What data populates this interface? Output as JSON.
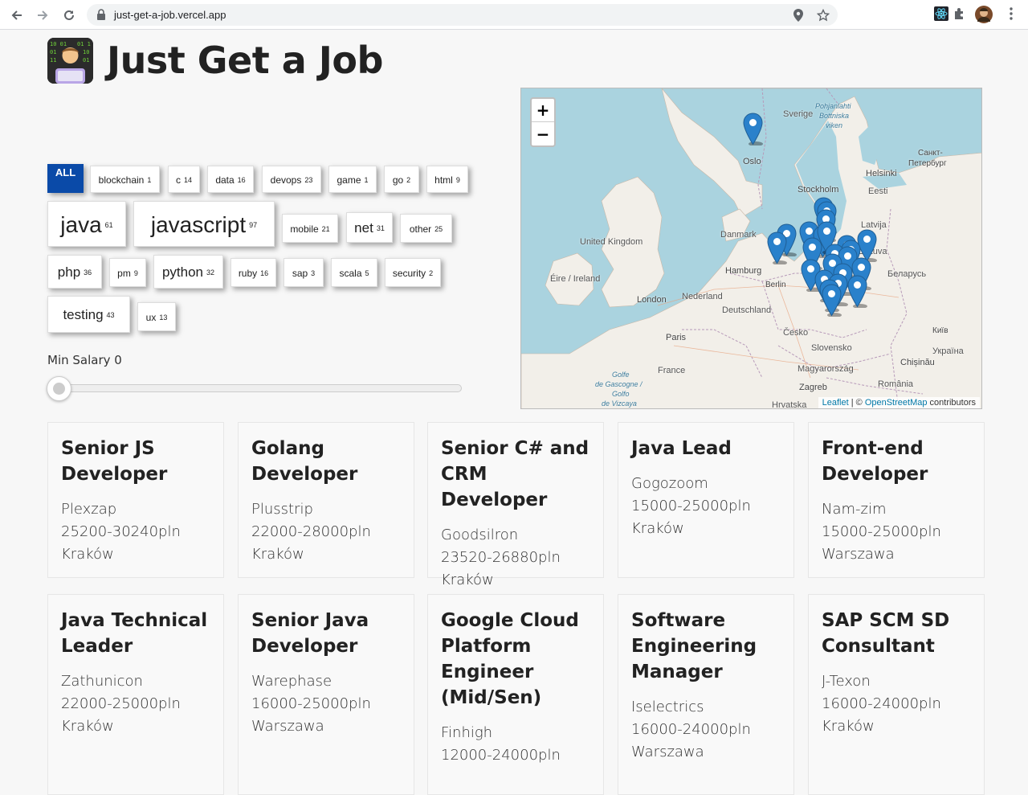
{
  "browser": {
    "url": "just-get-a-job.vercel.app"
  },
  "header": {
    "title": "Just Get a Job"
  },
  "filters": {
    "tags": [
      {
        "label": "ALL",
        "count": ""
      },
      {
        "label": "blockchain",
        "count": "1"
      },
      {
        "label": "c",
        "count": "14"
      },
      {
        "label": "data",
        "count": "16"
      },
      {
        "label": "devops",
        "count": "23"
      },
      {
        "label": "game",
        "count": "1"
      },
      {
        "label": "go",
        "count": "2"
      },
      {
        "label": "html",
        "count": "9"
      },
      {
        "label": "java",
        "count": "61"
      },
      {
        "label": "javascript",
        "count": "97"
      },
      {
        "label": "mobile",
        "count": "21"
      },
      {
        "label": "net",
        "count": "31"
      },
      {
        "label": "other",
        "count": "25"
      },
      {
        "label": "php",
        "count": "36"
      },
      {
        "label": "pm",
        "count": "9"
      },
      {
        "label": "python",
        "count": "32"
      },
      {
        "label": "ruby",
        "count": "16"
      },
      {
        "label": "sap",
        "count": "3"
      },
      {
        "label": "scala",
        "count": "5"
      },
      {
        "label": "security",
        "count": "2"
      },
      {
        "label": "testing",
        "count": "43"
      },
      {
        "label": "ux",
        "count": "13"
      }
    ],
    "salary_label": "Min Salary 0",
    "salary_value": 0
  },
  "map": {
    "zoom_in": "+",
    "zoom_out": "−",
    "labels": {
      "sverige": "Sverige",
      "bothnian": "Pohjanlahti",
      "bothnian2": "Bottniska",
      "bothnian3": "viken",
      "spb": "Санкт-",
      "spb2": "Петербург",
      "helsinki": "Helsinki",
      "oslo": "Oslo",
      "stockholm": "Stockholm",
      "eesti": "Eesti",
      "latvija": "Latvija",
      "danmark": "Danmark",
      "lietuva": "Lietuva",
      "uk": "United Kingdom",
      "hamburg": "Hamburg",
      "berlin": "Berlin",
      "belarus": "Беларусь",
      "eire": "Éire / Ireland",
      "nederland": "Nederland",
      "london": "London",
      "deutschland": "Deutschland",
      "kyiv": "Київ",
      "cesko": "Česko",
      "paris": "Paris",
      "slovensko": "Slovensko",
      "ukraina": "Україна",
      "france": "France",
      "magyar": "Magyarország",
      "chisinau": "Chișinău",
      "golfe1": "Golfe",
      "golfe2": "de Gascogne /",
      "golfe3": "Golfo",
      "golfe4": "de Vizcaya",
      "zagreb": "Zagreb",
      "romania": "România",
      "hrvatska": "Hrvatska"
    },
    "attribution_leaflet": "Leaflet",
    "attribution_sep": " | © ",
    "attribution_osm": "OpenStreetMap",
    "attribution_tail": " contributors"
  },
  "jobs": [
    {
      "title": "Senior JS Developer",
      "company": "Plexzap",
      "salary": "25200-30240pln",
      "city": "Kraków"
    },
    {
      "title": "Golang Developer",
      "company": "Plusstrip",
      "salary": "22000-28000pln",
      "city": "Kraków"
    },
    {
      "title": "Senior C# and CRM Developer",
      "company": "Goodsilron",
      "salary": "23520-26880pln",
      "city": "Kraków"
    },
    {
      "title": "Java Lead",
      "company": "Gogozoom",
      "salary": "15000-25000pln",
      "city": "Kraków"
    },
    {
      "title": "Front-end Developer",
      "company": "Nam-zim",
      "salary": "15000-25000pln",
      "city": "Warszawa"
    },
    {
      "title": "Java Technical Leader",
      "company": "Zathunicon",
      "salary": "22000-25000pln",
      "city": "Kraków"
    },
    {
      "title": "Senior Java Developer",
      "company": "Warephase",
      "salary": "16000-25000pln",
      "city": "Warszawa"
    },
    {
      "title": "Google Cloud Platform Engineer (Mid/Sen)",
      "company": "Finhigh",
      "salary": "12000-24000pln",
      "city": ""
    },
    {
      "title": "Software Engineering Manager",
      "company": "Iselectrics",
      "salary": "16000-24000pln",
      "city": "Warszawa"
    },
    {
      "title": "SAP SCM SD Consultant",
      "company": "J-Texon",
      "salary": "16000-24000pln",
      "city": "Kraków"
    }
  ],
  "colors": {
    "accent": "#0a4aa8",
    "marker": "#2a81cb",
    "water": "#aad3df",
    "land": "#f2efe9"
  }
}
